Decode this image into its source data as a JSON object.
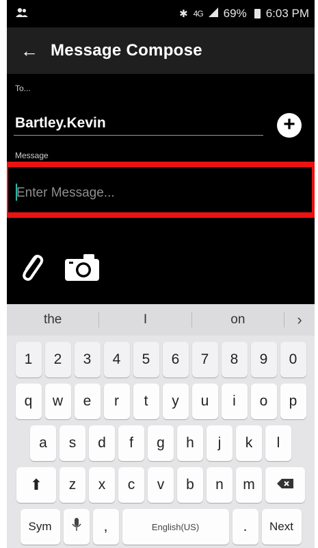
{
  "status_bar": {
    "battery": "69%",
    "time": "6:03 PM",
    "network": "4G",
    "icons": [
      "contacts-icon",
      "bluetooth-icon",
      "signal-icon",
      "battery-icon"
    ]
  },
  "app_bar": {
    "title": "Message Compose",
    "back_icon": "back-arrow-icon"
  },
  "compose": {
    "to_label": "To...",
    "to_value": "Bartley.Kevin",
    "add_recipient_icon": "add-circle-icon",
    "message_label": "Message",
    "message_placeholder": "Enter Message...",
    "message_value": "",
    "attach_icon": "paperclip-icon",
    "camera_icon": "camera-icon",
    "highlight_color": "#ee1111"
  },
  "keyboard": {
    "suggestions": [
      "the",
      "I",
      "on"
    ],
    "suggestion_arrow": "›",
    "number_row": [
      "1",
      "2",
      "3",
      "4",
      "5",
      "6",
      "7",
      "8",
      "9",
      "0"
    ],
    "row1": [
      "q",
      "w",
      "e",
      "r",
      "t",
      "y",
      "u",
      "i",
      "o",
      "p"
    ],
    "row2": [
      "a",
      "s",
      "d",
      "f",
      "g",
      "h",
      "j",
      "k",
      "l"
    ],
    "row3": [
      "z",
      "x",
      "c",
      "v",
      "b",
      "n",
      "m"
    ],
    "sym_label": "Sym",
    "comma": ",",
    "space_label": "English(US)",
    "period": ".",
    "next_label": "Next",
    "shift_icon": "shift-icon",
    "delete_icon": "backspace-icon",
    "mic_icon": "microphone-icon"
  },
  "colors": {
    "accent": "#2fa79c",
    "highlight": "#ee1111"
  }
}
